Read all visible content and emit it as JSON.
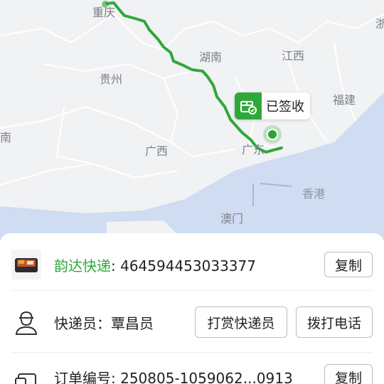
{
  "map": {
    "labels": {
      "chongqing": "重庆",
      "hunan": "湖南",
      "jiangxi": "江西",
      "guizhou": "贵州",
      "fujian": "福建",
      "guangxi": "广西",
      "guangdong": "广东",
      "hongkong": "香港",
      "macau": "澳门",
      "edge_left": "南",
      "edge_right": "浙"
    },
    "status_label": "已签收",
    "route_color": "#2fa83a"
  },
  "shipment": {
    "carrier": "韵达快递",
    "tracking_separator": ": ",
    "tracking_number": "464594453033377",
    "copy_label": "复制"
  },
  "courier": {
    "label": "快递员：覃昌员",
    "tip_button": "打赏快递员",
    "call_button": "拨打电话"
  },
  "order": {
    "label": "订单编号: 250805-1059062...0913",
    "copy_label": "复制"
  }
}
